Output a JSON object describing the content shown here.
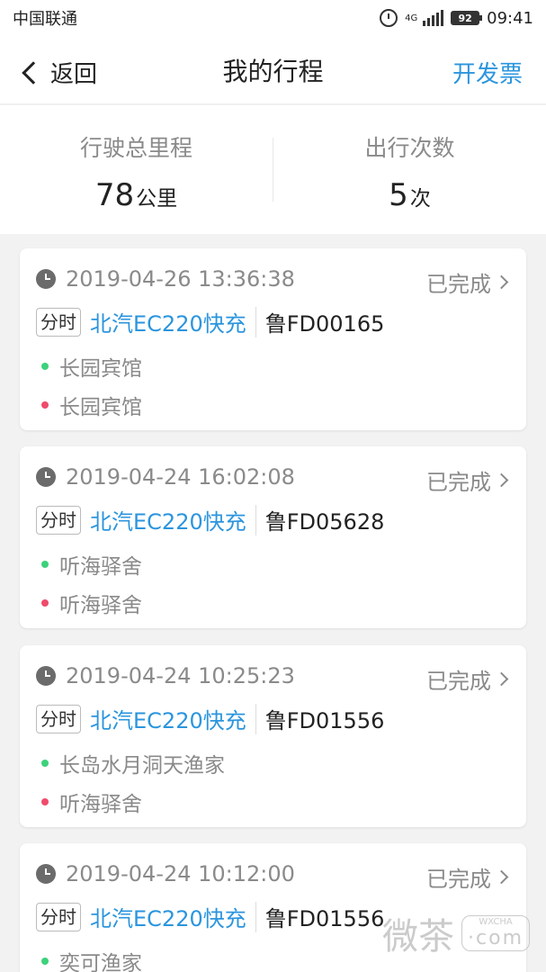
{
  "statusbar": {
    "carrier": "中国联通",
    "network": "4G",
    "battery": "92",
    "time": "09:41"
  },
  "nav": {
    "back_label": "返回",
    "title": "我的行程",
    "invoice_label": "开发票"
  },
  "summary": {
    "distance_label": "行驶总里程",
    "distance_value": "78",
    "distance_unit": "公里",
    "trips_label": "出行次数",
    "trips_value": "5",
    "trips_unit": "次"
  },
  "trips": [
    {
      "time": "2019-04-26 13:36:38",
      "status": "已完成",
      "tag": "分时",
      "model": "北汽EC220快充",
      "plate": "鲁FD00165",
      "start": "长园宾馆",
      "end": "长园宾馆"
    },
    {
      "time": "2019-04-24 16:02:08",
      "status": "已完成",
      "tag": "分时",
      "model": "北汽EC220快充",
      "plate": "鲁FD05628",
      "start": "听海驿舍",
      "end": "听海驿舍"
    },
    {
      "time": "2019-04-24 10:25:23",
      "status": "已完成",
      "tag": "分时",
      "model": "北汽EC220快充",
      "plate": "鲁FD01556",
      "start": "长岛水月洞天渔家",
      "end": "听海驿舍"
    },
    {
      "time": "2019-04-24 10:12:00",
      "status": "已完成",
      "tag": "分时",
      "model": "北汽EC220快充",
      "plate": "鲁FD01556",
      "start": "奕可渔家",
      "end": ""
    }
  ],
  "watermark": {
    "text": "微茶",
    "badge": "WXCHA",
    "sub": "·com"
  },
  "colors": {
    "accent": "#2b95de",
    "start_dot": "#3dd17a",
    "end_dot": "#ef4b6b"
  }
}
